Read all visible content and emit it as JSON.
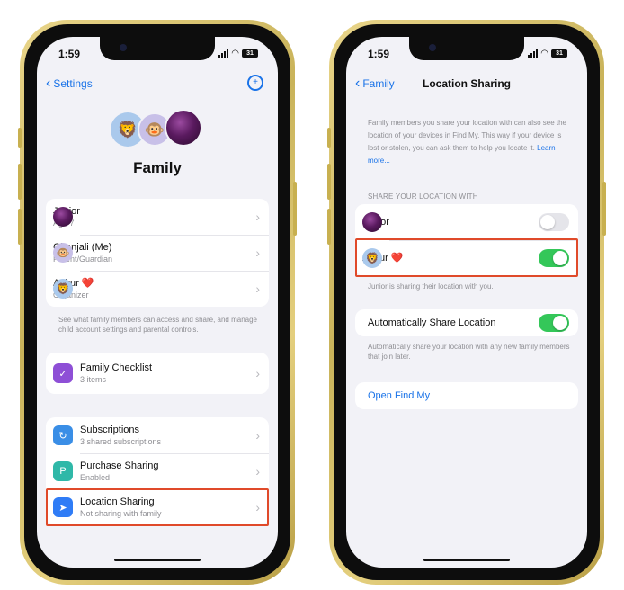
{
  "left": {
    "status": {
      "time": "1:59",
      "battery": "31"
    },
    "nav": {
      "back_label": "Settings"
    },
    "title": "Family",
    "members": [
      {
        "name": "Junior",
        "detail": "Age 7",
        "avatar": "purple-orb"
      },
      {
        "name": "Gitanjali (Me)",
        "detail": "Parent/Guardian",
        "avatar": "monkey",
        "emoji": "🐵"
      },
      {
        "name": "Ankur ❤️",
        "detail": "Organizer",
        "avatar": "lion",
        "emoji": "🦁"
      }
    ],
    "members_note": "See what family members can access and share, and manage child account settings and parental controls.",
    "checklist": {
      "label": "Family Checklist",
      "detail": "3 items",
      "icon": "checklist-icon",
      "color": "#8e4fd6"
    },
    "services": [
      {
        "label": "Subscriptions",
        "detail": "3 shared subscriptions",
        "icon": "subscriptions-icon",
        "color": "#3a8ee6"
      },
      {
        "label": "Purchase Sharing",
        "detail": "Enabled",
        "icon": "purchase-sharing-icon",
        "color": "#2fb8a8"
      },
      {
        "label": "Location Sharing",
        "detail": "Not sharing with family",
        "icon": "location-arrow-icon",
        "color": "#2f7cf6"
      }
    ]
  },
  "right": {
    "status": {
      "time": "1:59",
      "battery": "31"
    },
    "nav": {
      "back_label": "Family",
      "title": "Location Sharing"
    },
    "info_text": "Family members you share your location with can also see the location of your devices in Find My. This way if your device is lost or stolen, you can ask them to help you locate it.",
    "info_link": "Learn more...",
    "section_header": "SHARE YOUR LOCATION WITH",
    "share_with": [
      {
        "name": "Junior",
        "toggle": "off"
      },
      {
        "name": "Ankur ❤️",
        "toggle": "on",
        "emoji": "🦁"
      }
    ],
    "share_note": "Junior is sharing their location with you.",
    "auto_share": {
      "label": "Automatically Share Location",
      "toggle": "on"
    },
    "auto_note": "Automatically share your location with any new family members that join later.",
    "find_my": "Open Find My"
  },
  "colors": {
    "accent": "#1a73e8",
    "toggle_on": "#34c759",
    "highlight": "#e04a2a",
    "frame": "#d9c26a"
  }
}
